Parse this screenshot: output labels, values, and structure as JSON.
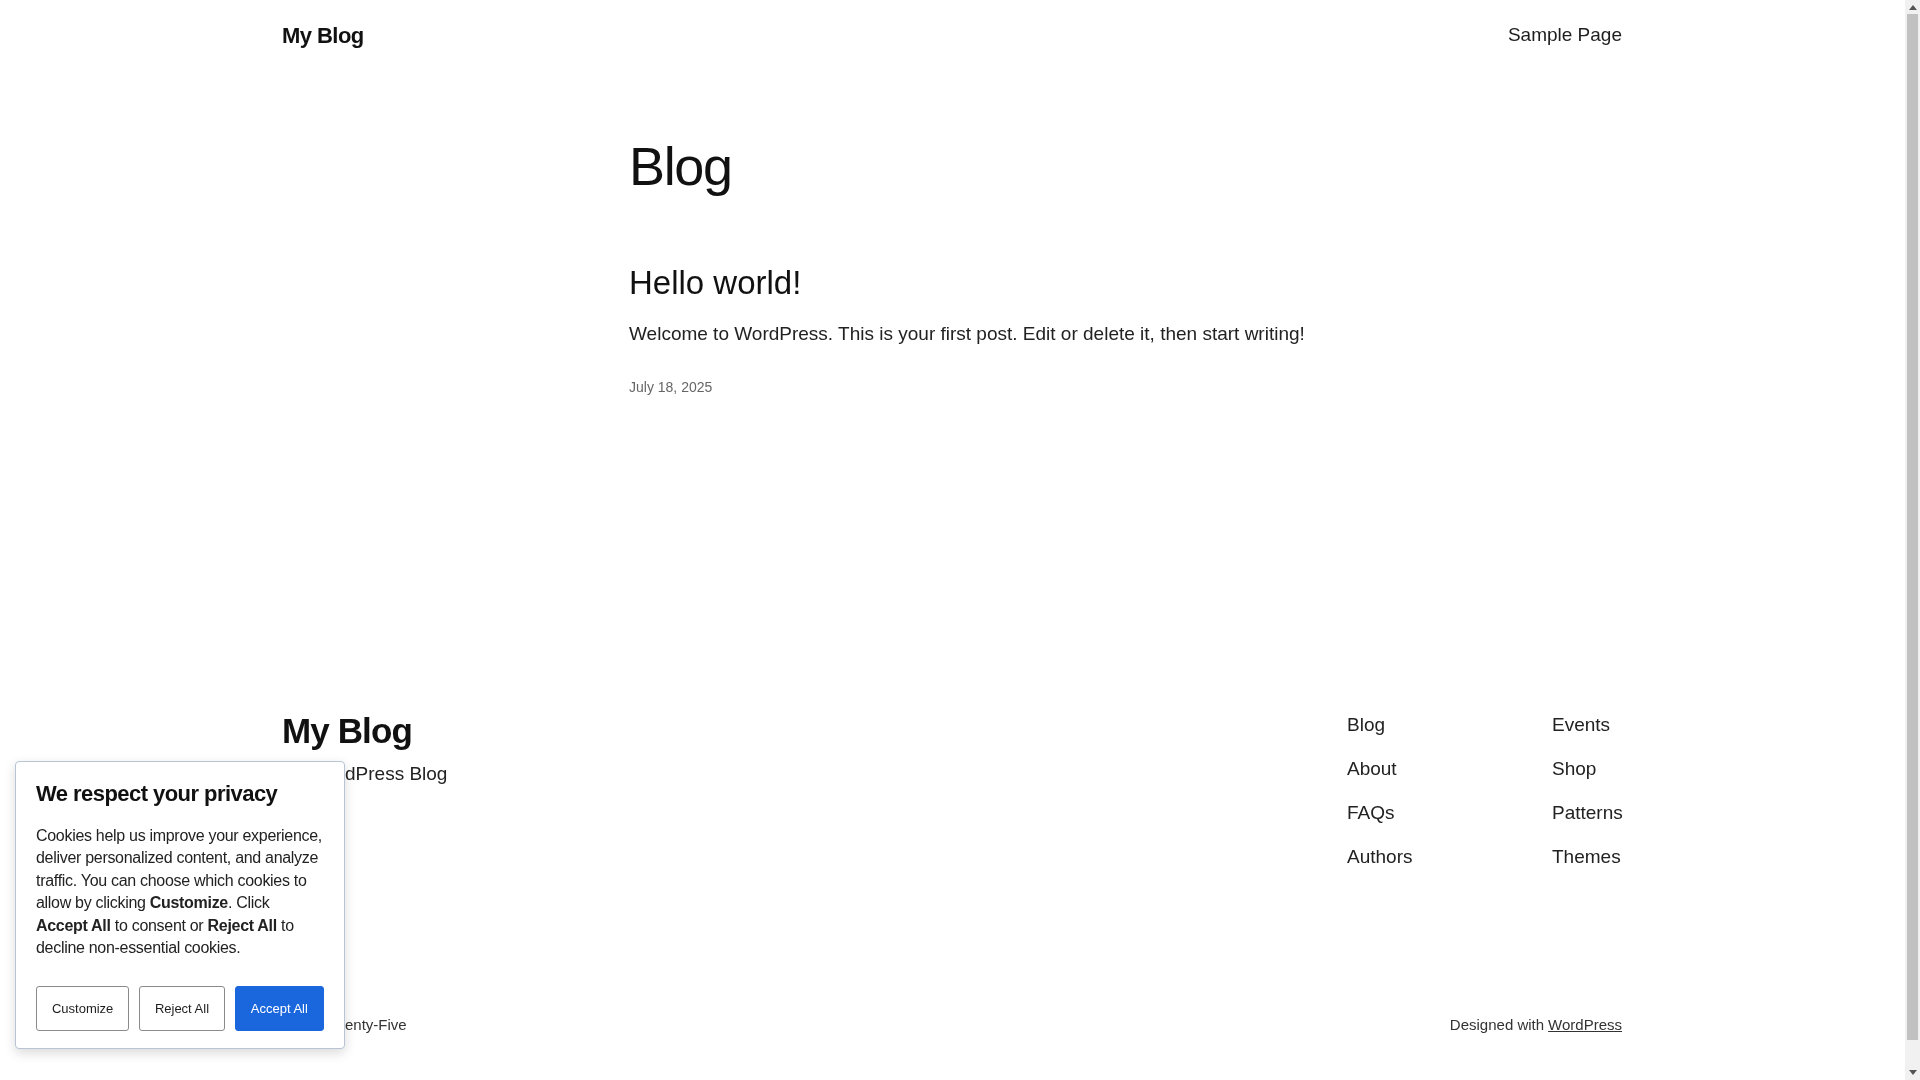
{
  "header": {
    "site_title": "My Blog",
    "nav": [
      "Sample Page"
    ]
  },
  "page_title": "Blog",
  "posts": [
    {
      "title": "Hello world!",
      "excerpt": "Welcome to WordPress. This is your first post. Edit or delete it, then start writing!",
      "date": "July 18, 2025"
    }
  ],
  "footer": {
    "site_title": "My Blog",
    "tagline": "dPress Blog",
    "nav_columns": [
      [
        "Blog",
        "About",
        "FAQs",
        "Authors"
      ],
      [
        "Events",
        "Shop",
        "Patterns",
        "Themes"
      ]
    ],
    "theme_credit": "enty-Five",
    "credit_prefix": "Designed with",
    "credit_link": "WordPress"
  },
  "cookie_banner": {
    "title": "We respect your privacy",
    "body": "Cookies help us improve your experience, deliver personalized content, and analyze traffic. You can choose which cookies to allow by clicking **Customize**. Click **Accept All** to consent or **Reject All** to decline non-essential cookies.",
    "buttons": [
      {
        "label": "Customize",
        "kind": "outline"
      },
      {
        "label": "Reject All",
        "kind": "outline"
      },
      {
        "label": "Accept All",
        "kind": "primary"
      }
    ]
  }
}
